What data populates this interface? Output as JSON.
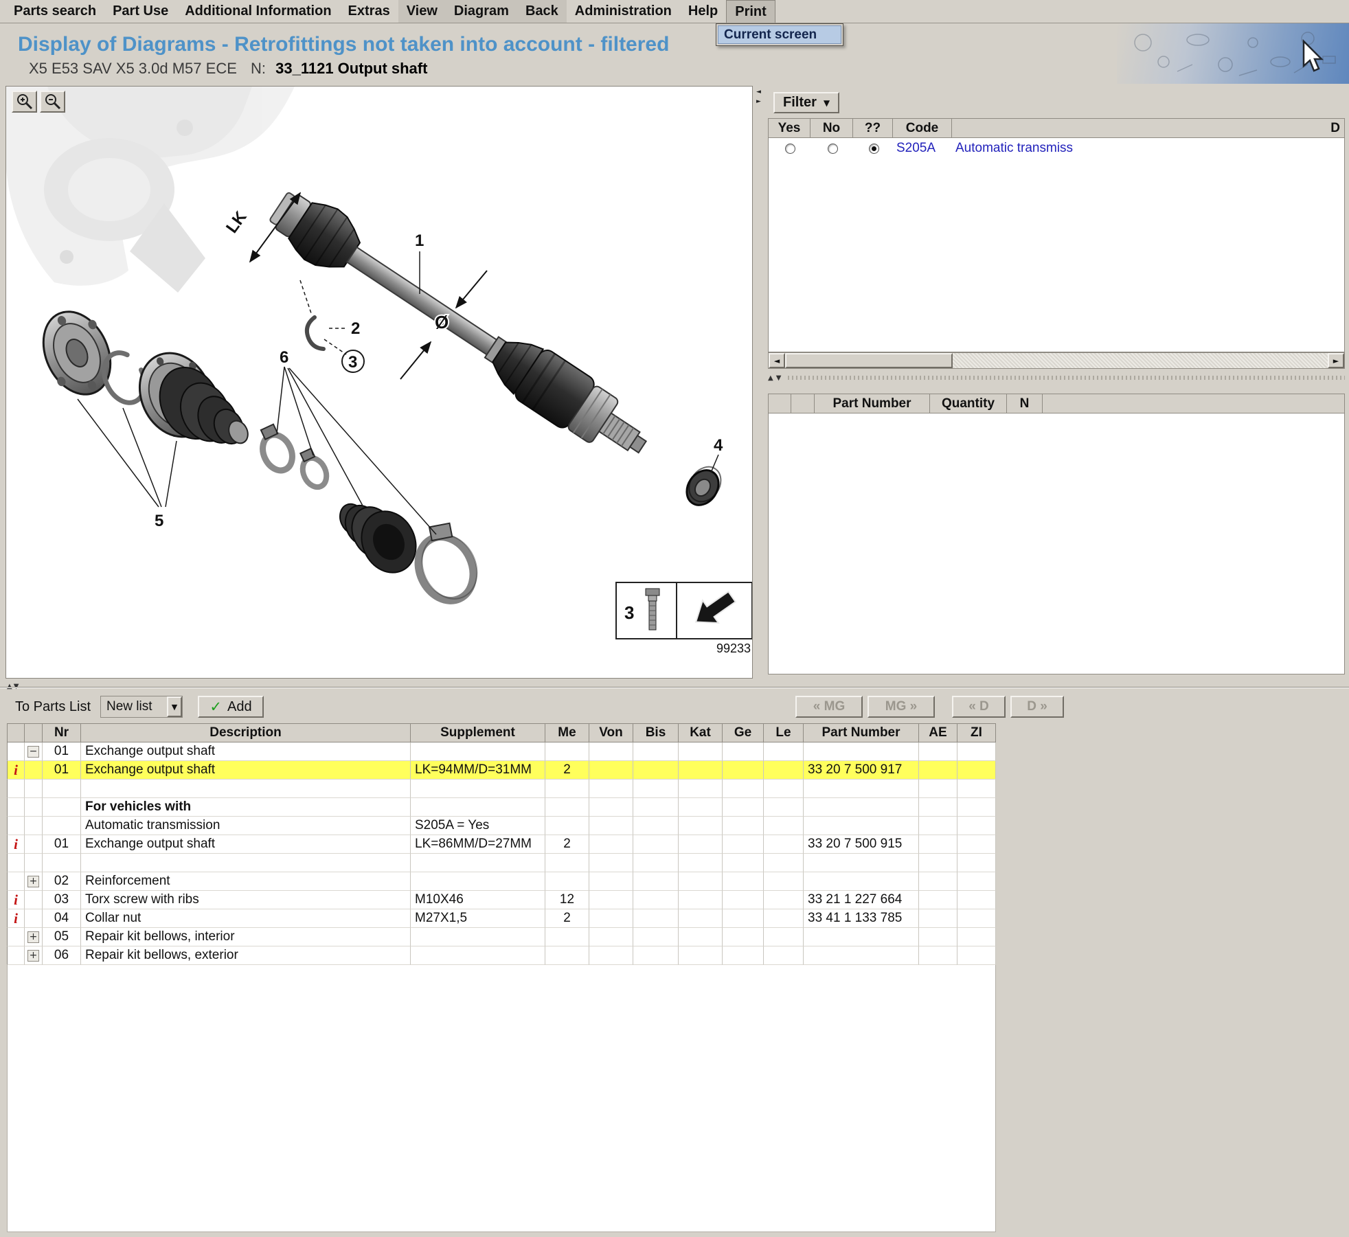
{
  "colors": {
    "window_bg": "#d5d1c9",
    "title_blue": "#4e92c8",
    "highlight_yellow": "#ffff5c",
    "link_blue": "#2222bb",
    "info_red": "#c41414"
  },
  "menu": {
    "items": [
      "Parts search",
      "Part Use",
      "Additional Information",
      "Extras",
      "View",
      "Diagram",
      "Back",
      "Administration",
      "Help",
      "Print"
    ],
    "print_popup_item": "Current screen"
  },
  "header": {
    "title": "Display of Diagrams - Retrofittings not taken into account - filtered",
    "vehicle": "X5 E53 SAV X5 3.0d M57 ECE",
    "n_label": "N:",
    "diagram_ref": "33_1121 Output shaft"
  },
  "diagram": {
    "callouts": {
      "lk": "LK",
      "c1": "1",
      "c2": "2",
      "c3": "3",
      "c4": "4",
      "c5": "5",
      "c6": "6"
    },
    "diameter_symbol": "Ø",
    "legend_number": "3",
    "drawing_number": "99233"
  },
  "filter_panel": {
    "filter_button": "Filter",
    "headers": {
      "yes": "Yes",
      "no": "No",
      "unknown": "??",
      "code": "Code",
      "description": "D"
    },
    "row": {
      "code": "S205A",
      "description": "Automatic transmiss",
      "selected_option": "??"
    }
  },
  "availability_table": {
    "headers": {
      "part_number": "Part Number",
      "quantity": "Quantity",
      "n": "N"
    }
  },
  "parts_bar": {
    "label": "To Parts List",
    "list_value": "New list",
    "add_check": "✓",
    "add_label": "Add",
    "nav": {
      "mg_prev": "« MG",
      "mg_next": "MG »",
      "d_prev": "« D",
      "d_next": "D »"
    }
  },
  "parts_table": {
    "headers": {
      "nr": "Nr",
      "description": "Description",
      "supplement": "Supplement",
      "me": "Me",
      "von": "Von",
      "bis": "Bis",
      "kat": "Kat",
      "ge": "Ge",
      "le": "Le",
      "part_number": "Part Number",
      "ae": "AE",
      "zi": "ZI"
    },
    "rows": [
      {
        "toggle": "−",
        "nr": "01",
        "description": "Exchange output shaft"
      },
      {
        "info": "i",
        "nr": "01",
        "description": "Exchange output shaft",
        "supplement": "LK=94MM/D=31MM",
        "me": "2",
        "part_number": "33 20 7 500 917",
        "highlighted": true
      },
      {},
      {
        "description": "For vehicles with",
        "bold": true
      },
      {
        "description": "Automatic transmission",
        "supplement": "S205A = Yes"
      },
      {
        "info": "i",
        "nr": "01",
        "description": "Exchange output shaft",
        "supplement": "LK=86MM/D=27MM",
        "me": "2",
        "part_number": "33 20 7 500 915"
      },
      {},
      {
        "toggle": "+",
        "nr": "02",
        "description": "Reinforcement"
      },
      {
        "info": "i",
        "nr": "03",
        "description": "Torx screw with ribs",
        "supplement": "M10X46",
        "me": "12",
        "part_number": "33 21 1 227 664"
      },
      {
        "info": "i",
        "nr": "04",
        "description": "Collar nut",
        "supplement": "M27X1,5",
        "me": "2",
        "part_number": "33 41 1 133 785"
      },
      {
        "toggle": "+",
        "nr": "05",
        "description": "Repair kit bellows, interior"
      },
      {
        "toggle": "+",
        "nr": "06",
        "description": "Repair kit bellows, exterior"
      }
    ]
  },
  "icons": {
    "left_arrow": "◄",
    "right_arrow": "►",
    "up_arrow": "▲",
    "down_arrow": "▼",
    "collapse_left": "◄",
    "collapse_right": "►",
    "dropdown_arrow": "▼"
  }
}
